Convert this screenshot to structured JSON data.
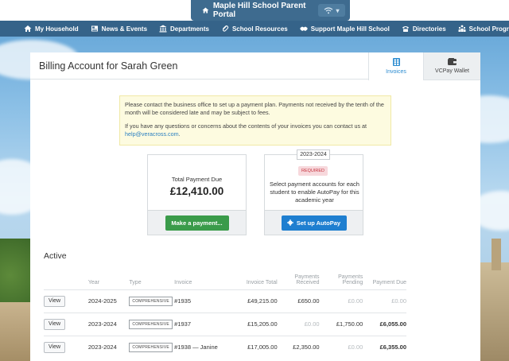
{
  "portal": {
    "title": "Maple Hill School Parent Portal"
  },
  "nav": {
    "items": [
      {
        "label": "My Household",
        "icon": "home-icon"
      },
      {
        "label": "News & Events",
        "icon": "newspaper-icon"
      },
      {
        "label": "Departments",
        "icon": "building-icon"
      },
      {
        "label": "School Resources",
        "icon": "paperclip-icon"
      },
      {
        "label": "Support Maple Hill School",
        "icon": "handshake-icon"
      },
      {
        "label": "Directories",
        "icon": "phone-icon"
      },
      {
        "label": "School Programmes",
        "icon": "people-icon"
      }
    ]
  },
  "page": {
    "title": "Billing Account for Sarah Green",
    "tabs": {
      "invoices": "Invoices",
      "wallet": "VCPay Wallet"
    }
  },
  "notice": {
    "line1": "Please contact the business office to set up a payment plan. Payments not received by the tenth of the month will be considered late and may be subject to fees.",
    "line2": "If you have any questions or concerns about the contents of your invoices you can contact us at",
    "email": "help@veracross.com",
    "email_suffix": "."
  },
  "payment": {
    "label": "Total Payment Due",
    "amount": "£12,410.00",
    "button": "Make a payment..."
  },
  "autopay": {
    "year": "2023-2024",
    "badge": "REQUIRED",
    "text": "Select payment accounts for each student to enable AutoPay for this academic year",
    "button": "Set up AutoPay"
  },
  "invoices": {
    "section_title": "Active",
    "headers": {
      "year": "Year",
      "type": "Type",
      "invoice": "Invoice",
      "total": "Invoice Total",
      "received": "Payments Received",
      "pending": "Payments Pending",
      "due": "Payment Due"
    },
    "view_label": "View",
    "rows": [
      {
        "year": "2024-2025",
        "type": "COMPREHENSIVE",
        "invoice": "#1935",
        "total": "£49,215.00",
        "received": "£650.00",
        "pending": "£0.00",
        "due": "£0.00"
      },
      {
        "year": "2023-2024",
        "type": "COMPREHENSIVE",
        "invoice": "#1937",
        "total": "£15,205.00",
        "received": "£0.00",
        "pending": "£1,750.00",
        "due": "£6,055.00"
      },
      {
        "year": "2023-2024",
        "type": "COMPREHENSIVE",
        "invoice": "#1938 — Janine",
        "total": "£17,005.00",
        "received": "£2,350.00",
        "pending": "£0.00",
        "due": "£6,355.00"
      }
    ]
  }
}
